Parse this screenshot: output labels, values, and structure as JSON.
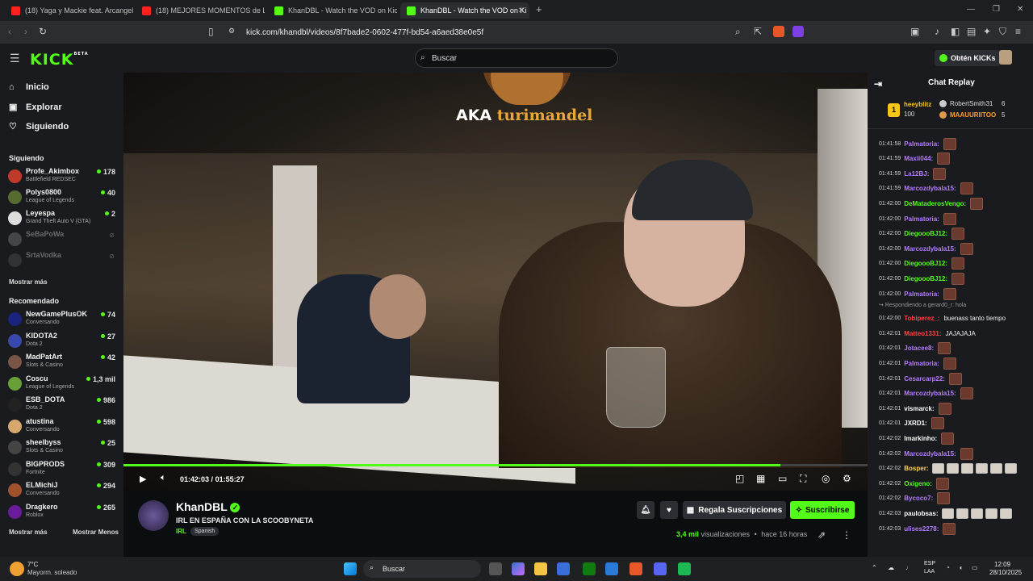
{
  "tabs": [
    {
      "title": "(18) Yaga y Mackie feat. Arcangel y d",
      "color": "#ff2020"
    },
    {
      "title": "(18) MEJORES MOMENTOS de LA SC",
      "color": "#ff2020"
    },
    {
      "title": "KhanDBL - Watch the VOD on Kick",
      "color": "#53fc18"
    },
    {
      "title": "KhanDBL - Watch the VOD on Ki",
      "color": "#53fc18"
    }
  ],
  "url": "kick.com/khandbl/videos/8f7bade2-0602-477f-bd54-a6aed38e0e5f",
  "header": {
    "logo": "KICK",
    "beta": "BETA",
    "search_placeholder": "Buscar",
    "kicks_label": "Obtén KICKs"
  },
  "nav": [
    {
      "label": "Inicio",
      "icon": "home-icon"
    },
    {
      "label": "Explorar",
      "icon": "explore-icon"
    },
    {
      "label": "Siguiendo",
      "icon": "heart-icon"
    }
  ],
  "following_header": "Siguiendo",
  "following": [
    {
      "name": "Profe_Akimbox",
      "category": "Battlefield REDSEC",
      "viewers": "178",
      "color": "#c0392b"
    },
    {
      "name": "Polys0800",
      "category": "League of Legends",
      "viewers": "40",
      "color": "#556b2f"
    },
    {
      "name": "Leyespa",
      "category": "Grand Theft Auto V (GTA)",
      "viewers": "2",
      "color": "#ddd"
    },
    {
      "name": "SeBaPoWa",
      "category": "",
      "viewers": "",
      "color": "#888"
    },
    {
      "name": "SrtaVodka",
      "category": "",
      "viewers": "",
      "color": "#555"
    }
  ],
  "show_more": "Mostrar más",
  "recommended_header": "Recomendado",
  "recommended": [
    {
      "name": "NewGamePlusOK",
      "category": "Conversando",
      "viewers": "74",
      "color": "#1a237e"
    },
    {
      "name": "KIDOTA2",
      "category": "Dota 2",
      "viewers": "27",
      "color": "#3949ab"
    },
    {
      "name": "MadPatArt",
      "category": "Slots & Casino",
      "viewers": "42",
      "color": "#795548"
    },
    {
      "name": "Coscu",
      "category": "League of Legends",
      "viewers": "1,3 mil",
      "color": "#689f38"
    },
    {
      "name": "ESB_DOTA",
      "category": "Dota 2",
      "viewers": "986",
      "color": "#222"
    },
    {
      "name": "atustina",
      "category": "Conversando",
      "viewers": "598",
      "color": "#d7a86e"
    },
    {
      "name": "sheelbyss",
      "category": "Slots & Casino",
      "viewers": "25",
      "color": "#444"
    },
    {
      "name": "BIGPRODS",
      "category": "Fortnite",
      "viewers": "309",
      "color": "#333"
    },
    {
      "name": "ELMichiJ",
      "category": "Conversando",
      "viewers": "294",
      "color": "#a0522d"
    },
    {
      "name": "Dragkero",
      "category": "Roblox",
      "viewers": "265",
      "color": "#6a1b9a"
    }
  ],
  "show_less": "Mostrar Menos",
  "overlay": {
    "aka": "AKA",
    "name": "turimandel"
  },
  "player": {
    "current": "01:42:03",
    "separator": "/",
    "duration": "01:55:27",
    "progress": 0.883
  },
  "stream": {
    "channel": "KhanDBL",
    "title": "IRL EN ESPAÑA CON LA SCOOBYNETA",
    "category": "IRL",
    "language": "Spanish",
    "gift_label": "Regala Suscripciones",
    "subscribe_label": "Suscribirse",
    "views_count": "3,4 mil",
    "views_label": "visualizaciones",
    "dot": "•",
    "age": "hace 16 horas"
  },
  "chat": {
    "title": "Chat Replay",
    "leader1": {
      "rank": "1",
      "name": "heeyblitz",
      "amount": "100"
    },
    "leader2": {
      "name": "RobertSmith31",
      "amount": "6"
    },
    "leader3": {
      "name": "MAAUURIITOO",
      "amount": "5"
    },
    "reply_note": "Respondiendo a gerard0_r: hola",
    "messages": [
      {
        "ts": "01:41:58",
        "user": "Palmatoria:",
        "color": "#b57bff",
        "emotes": 1
      },
      {
        "ts": "01:41:59",
        "user": "Maxii044:",
        "color": "#b57bff",
        "emotes": 1
      },
      {
        "ts": "01:41:59",
        "user": "La12BJ:",
        "color": "#b57bff",
        "emotes": 1
      },
      {
        "ts": "01:41:59",
        "user": "Marcozdybala15:",
        "color": "#b57bff",
        "emotes": 1
      },
      {
        "ts": "01:42:00",
        "user": "DeMataderosVengo:",
        "color": "#53fc18",
        "emotes": 1
      },
      {
        "ts": "01:42:00",
        "user": "Palmatoria:",
        "color": "#b57bff",
        "emotes": 1
      },
      {
        "ts": "01:42:00",
        "user": "DiegoooBJ12:",
        "color": "#53fc18",
        "emotes": 1
      },
      {
        "ts": "01:42:00",
        "user": "Marcozdybala15:",
        "color": "#b57bff",
        "emotes": 1
      },
      {
        "ts": "01:42:00",
        "user": "DiegoooBJ12:",
        "color": "#53fc18",
        "emotes": 1
      },
      {
        "ts": "01:42:00",
        "user": "DiegoooBJ12:",
        "color": "#53fc18",
        "emotes": 1
      },
      {
        "ts": "01:42:00",
        "user": "Palmatoria:",
        "color": "#b57bff",
        "emotes": 1
      },
      {
        "ts": "01:42:00",
        "user": "Tobiperez_:",
        "color": "#ff4040",
        "text": "buenass tanto tiempo"
      },
      {
        "ts": "01:42:01",
        "user": "Matteo1331:",
        "color": "#ff4040",
        "text": "JAJAJAJA"
      },
      {
        "ts": "01:42:01",
        "user": "Jotacee8:",
        "color": "#b57bff",
        "emotes": 1
      },
      {
        "ts": "01:42:01",
        "user": "Palmatoria:",
        "color": "#b57bff",
        "emotes": 1
      },
      {
        "ts": "01:42:01",
        "user": "Cesarcarp22:",
        "color": "#b57bff",
        "emotes": 1
      },
      {
        "ts": "01:42:01",
        "user": "Marcozdybala15:",
        "color": "#b57bff",
        "emotes": 1
      },
      {
        "ts": "01:42:01",
        "user": "vismarck:",
        "color": "#ffffff",
        "emotes": 1
      },
      {
        "ts": "01:42:01",
        "user": "JXRD1:",
        "color": "#ffffff",
        "emotes": 1
      },
      {
        "ts": "01:42:02",
        "user": "Imarkinho:",
        "color": "#ffffff",
        "emotes": 1
      },
      {
        "ts": "01:42:02",
        "user": "Marcozdybala15:",
        "color": "#b57bff",
        "emotes": 1
      },
      {
        "ts": "01:42:02",
        "user": "Bosper:",
        "color": "#ffd34d",
        "emotes": 6,
        "small": true
      },
      {
        "ts": "01:42:02",
        "user": "Oxigeno:",
        "color": "#53fc18",
        "emotes": 1
      },
      {
        "ts": "01:42:02",
        "user": "Bycoco7:",
        "color": "#b57bff",
        "emotes": 1
      },
      {
        "ts": "01:42:03",
        "user": "paulobsas:",
        "color": "#ffffff",
        "emotes": 5,
        "small": true
      },
      {
        "ts": "01:42:03",
        "user": "ulises2278:",
        "color": "#b57bff",
        "emotes": 1
      }
    ]
  },
  "taskbar": {
    "temp": "7°C",
    "weather": "Mayorm. soleado",
    "search": "Buscar",
    "lang1": "ESP",
    "lang2": "LAA",
    "time": "12:09",
    "date": "28/10/2025"
  }
}
